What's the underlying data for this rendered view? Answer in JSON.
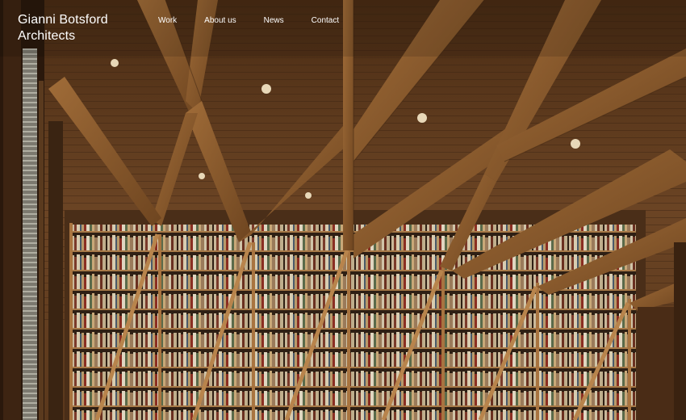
{
  "site": {
    "brand_line1": "Gianni Botsford",
    "brand_line2": "Architects"
  },
  "nav": {
    "items": [
      {
        "label": "Work"
      },
      {
        "label": "About us"
      },
      {
        "label": "News"
      },
      {
        "label": "Contact"
      }
    ]
  },
  "hero": {
    "image_subject": "library-interior-photo",
    "colors": {
      "ceiling": "#6b4424",
      "beam": "#8a5a2c",
      "shelf_wood": "#9a6a3a",
      "dark_wall": "#3a2414"
    }
  }
}
